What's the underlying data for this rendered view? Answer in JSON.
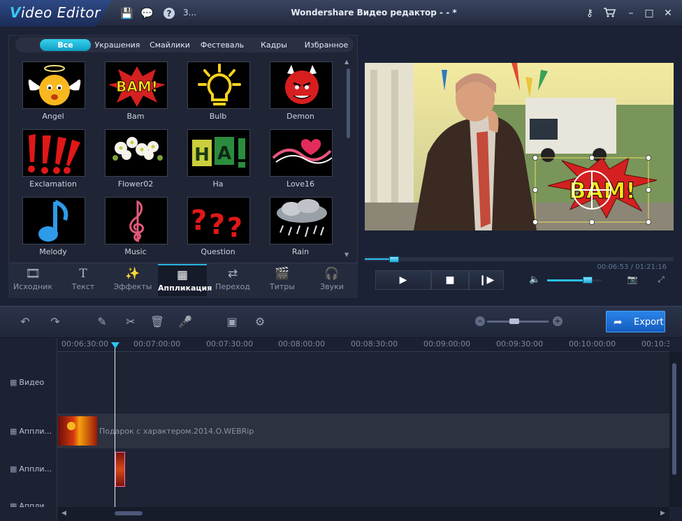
{
  "app": {
    "logo_initial": "V",
    "logo_rest": "ideo Editor",
    "title": "Wondershare Видео редактор - - *",
    "menu_more": "3..."
  },
  "library": {
    "categories": [
      "Все",
      "Украшения",
      "Смайлики",
      "Фестеваль",
      "Кадры",
      "Избранное"
    ],
    "active_category": "Все",
    "items": [
      {
        "label": "Angel",
        "icon": "angel-emoji"
      },
      {
        "label": "Bam",
        "icon": "bam-burst"
      },
      {
        "label": "Bulb",
        "icon": "light-bulb"
      },
      {
        "label": "Demon",
        "icon": "demon-emoji"
      },
      {
        "label": "Exclamation",
        "icon": "exclamation-marks"
      },
      {
        "label": "Flower02",
        "icon": "white-flowers"
      },
      {
        "label": "Ha",
        "icon": "ha-text"
      },
      {
        "label": "Love16",
        "icon": "heart-swirl"
      },
      {
        "label": "Melody",
        "icon": "music-note"
      },
      {
        "label": "Music",
        "icon": "treble-clef"
      },
      {
        "label": "Question",
        "icon": "question-marks"
      },
      {
        "label": "Rain",
        "icon": "rain-cloud"
      }
    ]
  },
  "tabs": [
    {
      "label": "Исходник",
      "icon": "film-icon"
    },
    {
      "label": "Текст",
      "icon": "text-t-icon"
    },
    {
      "label": "Эффекты",
      "icon": "magic-wand-icon"
    },
    {
      "label": "Аппликация",
      "icon": "filmstrip-icon",
      "active": true
    },
    {
      "label": "Переход",
      "icon": "transition-icon"
    },
    {
      "label": "Титры",
      "icon": "clapper-icon"
    },
    {
      "label": "Звуки",
      "icon": "headphones-icon"
    }
  ],
  "preview": {
    "timecode": "00:06:53 / 01:21:16",
    "overlay_text": "BAM!",
    "playback_progress": 0.09,
    "volume_level": 0.75
  },
  "toolbar": {
    "export_label": "Export",
    "zoom_level": 0.45
  },
  "timeline": {
    "ruler_ticks": [
      "00:06:30:00",
      "00:07:00:00",
      "00:07:30:00",
      "00:08:00:00",
      "00:08:30:00",
      "00:09:00:00",
      "00:09:30:00",
      "00:10:00:00",
      "00:10:3"
    ],
    "tracks": [
      {
        "label": "Видео"
      },
      {
        "label": "Аппли..."
      },
      {
        "label": "Аппли..."
      },
      {
        "label": "Аппли..."
      }
    ],
    "clip_name": "Подарок с характером.2014.O.WEBRip"
  },
  "colors": {
    "accent": "#2ab6df",
    "export": "#1f6fd6",
    "background": "#1b2235"
  }
}
